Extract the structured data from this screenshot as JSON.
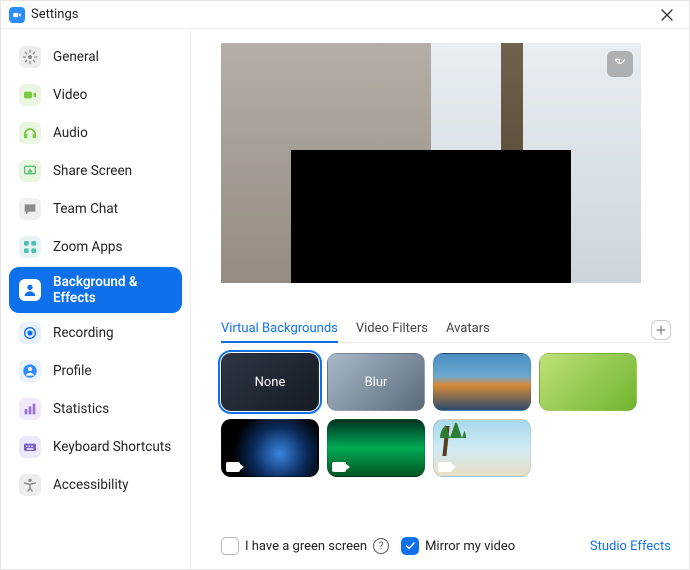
{
  "titlebar": {
    "title": "Settings"
  },
  "sidebar": {
    "items": [
      {
        "label": "General",
        "icon": "gear",
        "icon_bg": "#ededed",
        "icon_fg": "#8c8c8c"
      },
      {
        "label": "Video",
        "icon": "video",
        "icon_bg": "#e9f6e2",
        "icon_fg": "#7ac943"
      },
      {
        "label": "Audio",
        "icon": "audio",
        "icon_bg": "#e9f6e2",
        "icon_fg": "#7ac943"
      },
      {
        "label": "Share Screen",
        "icon": "share",
        "icon_bg": "#e9f6e2",
        "icon_fg": "#56c271"
      },
      {
        "label": "Team Chat",
        "icon": "chat",
        "icon_bg": "#f0f0f0",
        "icon_fg": "#8c8c8c"
      },
      {
        "label": "Zoom Apps",
        "icon": "apps",
        "icon_bg": "#e6f5f3",
        "icon_fg": "#4ac1b6"
      },
      {
        "label": "Background & Effects",
        "icon": "person",
        "icon_bg": "#ffffff",
        "icon_fg": "#0E71EB",
        "selected": true
      },
      {
        "label": "Recording",
        "icon": "record",
        "icon_bg": "#e8f1fd",
        "icon_fg": "#0E71EB"
      },
      {
        "label": "Profile",
        "icon": "profile",
        "icon_bg": "#e8f1fd",
        "icon_fg": "#2D8CFF"
      },
      {
        "label": "Statistics",
        "icon": "stats",
        "icon_bg": "#f0e9fb",
        "icon_fg": "#9b6dd7"
      },
      {
        "label": "Keyboard Shortcuts",
        "icon": "keyboard",
        "icon_bg": "#ece8fc",
        "icon_fg": "#7b61c4"
      },
      {
        "label": "Accessibility",
        "icon": "accessibility",
        "icon_bg": "#ededed",
        "icon_fg": "#8c8c8c"
      }
    ]
  },
  "tabs": {
    "items": [
      {
        "label": "Virtual Backgrounds",
        "active": true
      },
      {
        "label": "Video Filters"
      },
      {
        "label": "Avatars"
      }
    ]
  },
  "backgrounds": {
    "items": [
      {
        "name": "none",
        "label": "None",
        "selected": true
      },
      {
        "name": "blur",
        "label": "Blur"
      },
      {
        "name": "bridge",
        "label": ""
      },
      {
        "name": "grass",
        "label": ""
      },
      {
        "name": "earth",
        "label": "",
        "video": true
      },
      {
        "name": "aurora",
        "label": "",
        "video": true
      },
      {
        "name": "beach",
        "label": "",
        "video": true
      }
    ]
  },
  "footer": {
    "green_screen_label": "I have a green screen",
    "green_screen_checked": false,
    "mirror_label": "Mirror my video",
    "mirror_checked": true,
    "studio_label": "Studio Effects"
  }
}
